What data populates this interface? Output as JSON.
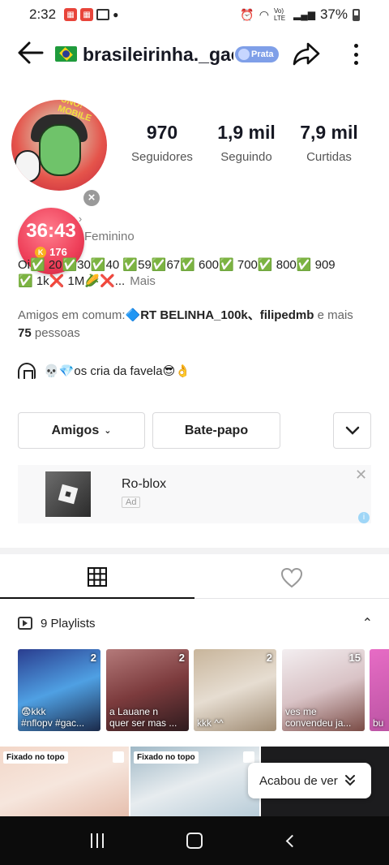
{
  "status_bar": {
    "time": "2:32",
    "notifications": [
      "notif-icon",
      "notif-icon",
      "image-icon",
      "dot"
    ],
    "signal": "Vo) LTE",
    "battery": "37%"
  },
  "header": {
    "username": "brasileirinha._gac",
    "badge": "Prata"
  },
  "stats": [
    {
      "value": "970",
      "label": "Seguidores"
    },
    {
      "value": "1,9 mil",
      "label": "Seguindo"
    },
    {
      "value": "7,9 mil",
      "label": "Curtidas"
    }
  ],
  "meta_line": "o ›",
  "gender": "Feminino",
  "timer": {
    "time": "36:43",
    "coins": "176",
    "coin_letter": "K"
  },
  "bio": {
    "line1": "Oi✅ 20✅30✅40 ✅59✅67✅ 600✅ 700✅ 800✅ 909",
    "line2": "✅ 1k❌ 1M🌽❌...",
    "more": "Mais"
  },
  "friends": {
    "prefix": "Amigos em comum:",
    "names": "🔷RT BELINHA_100k、filipedmb",
    "suffix": " e mais",
    "count": "75",
    "count_suffix": " pessoas"
  },
  "group": {
    "text": "💀💎os cria da favela😎👌"
  },
  "buttons": {
    "friends": "Amigos",
    "chat": "Bate-papo"
  },
  "ad": {
    "title": "Ro-blox",
    "tag": "Ad",
    "close": "✕",
    "info": "i"
  },
  "playlists": {
    "title": "9 Playlists",
    "items": [
      {
        "count": "2",
        "caption": "😨kkk\n#nflopv #gac..."
      },
      {
        "count": "2",
        "caption": "a Lauane n\nquer ser mas ..."
      },
      {
        "count": "2",
        "caption": "kkk ^^"
      },
      {
        "count": "15",
        "caption": "ves me\nconvendeu ja..."
      },
      {
        "count": "",
        "caption": "bu"
      }
    ]
  },
  "videos": {
    "pinned_label": "Fixado no topo",
    "watched": "Acabou de ver"
  },
  "colors": {
    "timer": "#ee3f59",
    "badge": "#7f9fe8",
    "nav": "#0c0c0c"
  }
}
